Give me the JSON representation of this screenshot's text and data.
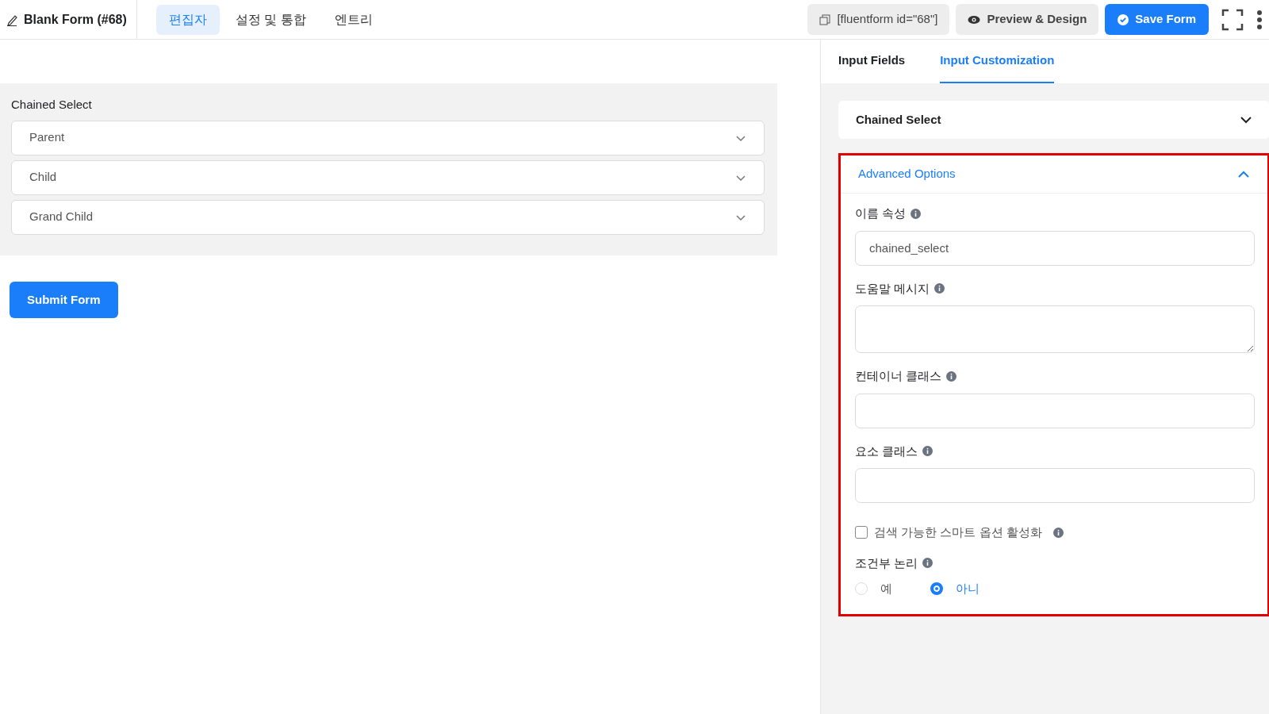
{
  "header": {
    "title": "Blank Form (#68)",
    "tabs": [
      {
        "label": "편집자",
        "selected": true
      },
      {
        "label": "설정 및 통합",
        "selected": false
      },
      {
        "label": "엔트리",
        "selected": false
      }
    ],
    "shortcode": "[fluentform id=\"68\"]",
    "preview": "Preview & Design",
    "save": "Save Form"
  },
  "form": {
    "group_label": "Chained Select",
    "selects": [
      {
        "placeholder": "Parent"
      },
      {
        "placeholder": "Child"
      },
      {
        "placeholder": "Grand Child"
      }
    ],
    "submit": "Submit Form"
  },
  "sidebar": {
    "tabs": [
      {
        "label": "Input Fields",
        "selected": false
      },
      {
        "label": "Input Customization",
        "selected": true
      }
    ],
    "sections": [
      {
        "title": "Chained Select",
        "expanded": false
      },
      {
        "title": "Advanced Options",
        "expanded": true,
        "highlighted": true
      }
    ],
    "fields": [
      {
        "kind": "input",
        "label": "이름 속성",
        "value": "chained_select"
      },
      {
        "kind": "textarea",
        "label": "도움말 메시지"
      },
      {
        "kind": "input",
        "label": "컨테이너 클래스"
      },
      {
        "kind": "input",
        "label": "요소 클래스"
      },
      {
        "kind": "checkbox",
        "label": "검색 가능한 스마트 옵션 활성화",
        "checked": false
      },
      {
        "kind": "radio",
        "label": "조건부 논리",
        "options": [
          {
            "label": "예",
            "selected": false
          },
          {
            "label": "아니",
            "selected": true
          }
        ]
      }
    ]
  }
}
